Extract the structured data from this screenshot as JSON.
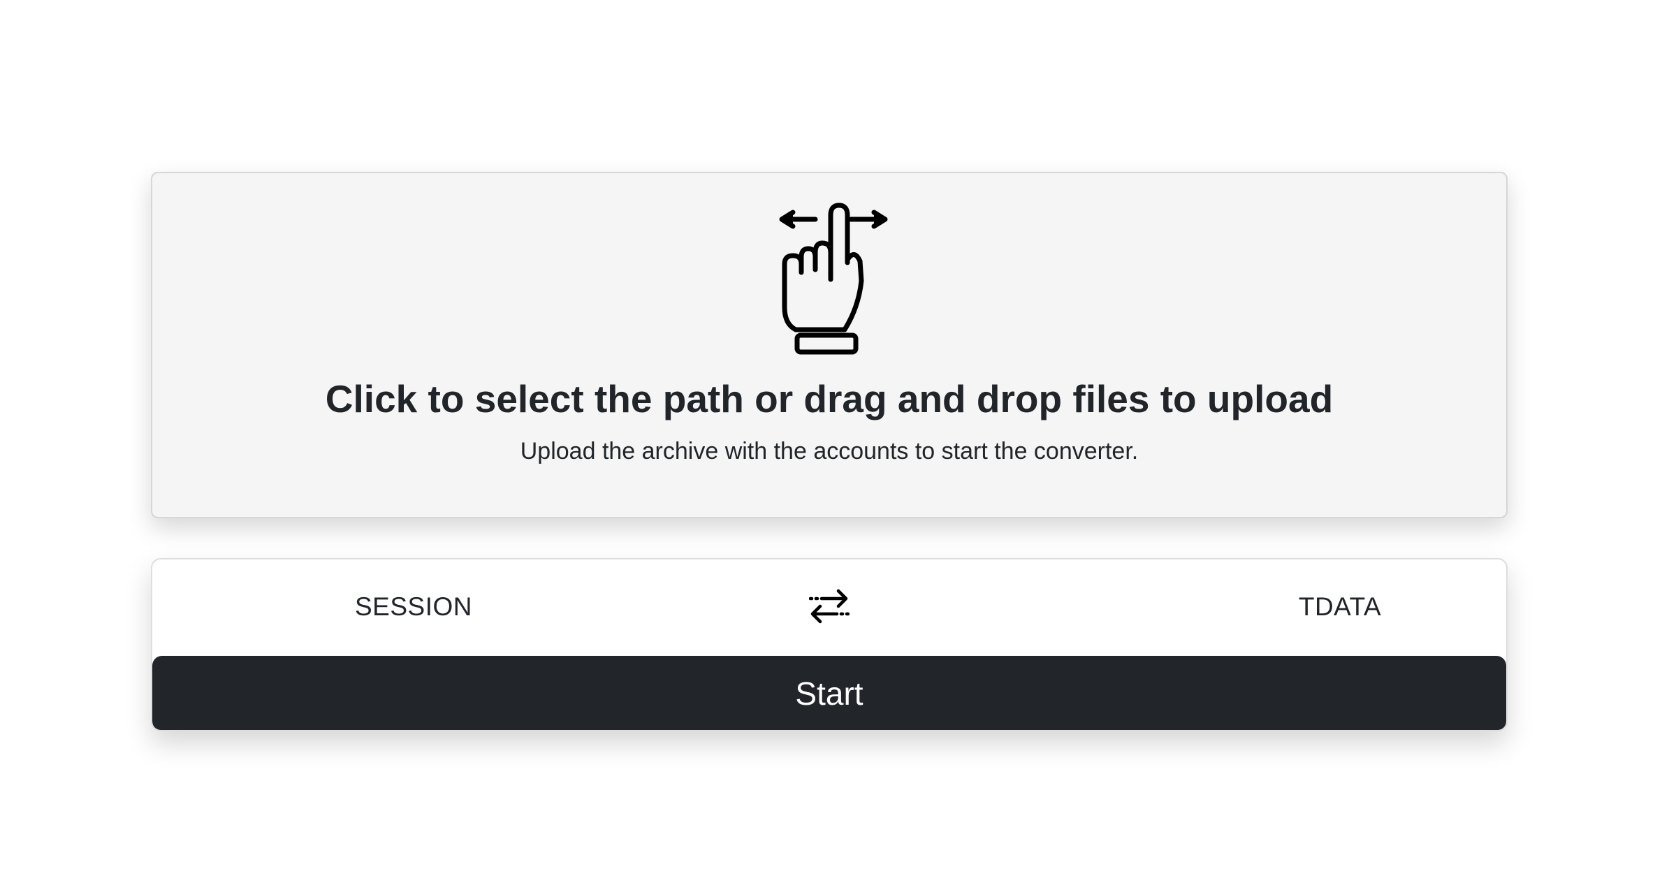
{
  "dropzone": {
    "title": "Click to select the path or drag and drop files to upload",
    "subtitle": "Upload the archive with the accounts to start the converter.",
    "icon": "swipe-hand-icon"
  },
  "converter": {
    "from_format": "SESSION",
    "to_format": "TDATA",
    "swap_icon": "swap-arrows-icon",
    "start_label": "Start"
  }
}
